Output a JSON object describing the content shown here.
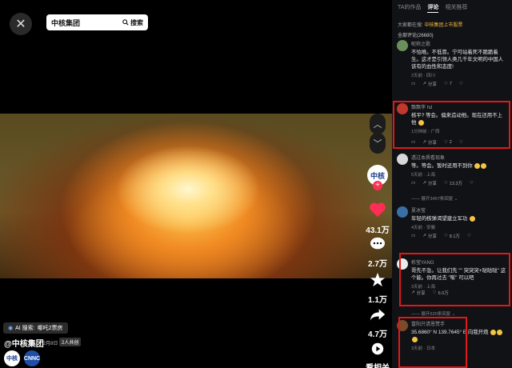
{
  "search": {
    "query": "中核集团",
    "button_label": "搜索"
  },
  "actions": {
    "like_count": "43.1万",
    "comment_count": "2.7万",
    "favorite_count": "1.1万",
    "share_count": "4.7万",
    "related_label": "看相关"
  },
  "post": {
    "ai_prefix": "AI 搜索:",
    "ai_query": "哪吒2票房",
    "author": "@中核集团",
    "date": "· 2月8日",
    "co_creators": "2人共创"
  },
  "panel": {
    "tabs": [
      "TA的作品",
      "评论",
      "相关推荐"
    ],
    "active_tab": 1,
    "search_hint_prefix": "大家都在搜:",
    "search_hint_link": "中核集团上市股票",
    "total_comments": "全部评论(26680)",
    "comments": [
      {
        "name": "昵称之歌",
        "text": "不怕堆。不低冒。宁可站着死不跪跪着生。这才是引领人类几千年文明的中国人该有的血性和态度!",
        "meta": "2天前 · 四川",
        "share": "分享",
        "likes": "7",
        "avatar_color": "#6b8f5a"
      },
      {
        "name": "飘飘李 hd",
        "text": "核平? 等会。偏来造动他。现在还用不上他",
        "meta": "1分钟前 · 广西",
        "share": "分享",
        "likes": "2",
        "avatar_color": "#c0392b"
      },
      {
        "name": "透过本质看现象",
        "text": "等。等会。暂时还用不到你",
        "meta": "5天前 · 上海",
        "share": "分享",
        "likes": "13.3万",
        "avatar_color": "#d8d8d8"
      },
      {
        "name": "夏冰莹",
        "text": "年轻的核弹渴望建立军功",
        "meta": "4天前 · 安徽",
        "share": "分享",
        "likes": "8.1万",
        "avatar_color": "#3a6ea5"
      },
      {
        "name": "栋莹YANG",
        "text": "哥先不急。让我们先 \"\" 突突突+哒哒哒\" 这个能。你再过去 \"嘭\" 可以吧",
        "meta": "3天前 · 上海",
        "share": "分享",
        "likes": "6.0万",
        "avatar_color": "#eaeaea"
      },
      {
        "name": "富阳只请恩赞手",
        "text": "35.6860° N 139.7645° E 向我开炮",
        "meta": "3天前 · 日本",
        "share": "",
        "likes": "",
        "avatar_color": "#7a4a2a"
      }
    ],
    "expand_labels": [
      "展开3457条回复",
      "展开620条回复"
    ]
  },
  "colors": {
    "highlight": "#e01818",
    "like": "#ff2d55",
    "panel_bg": "#111216"
  }
}
